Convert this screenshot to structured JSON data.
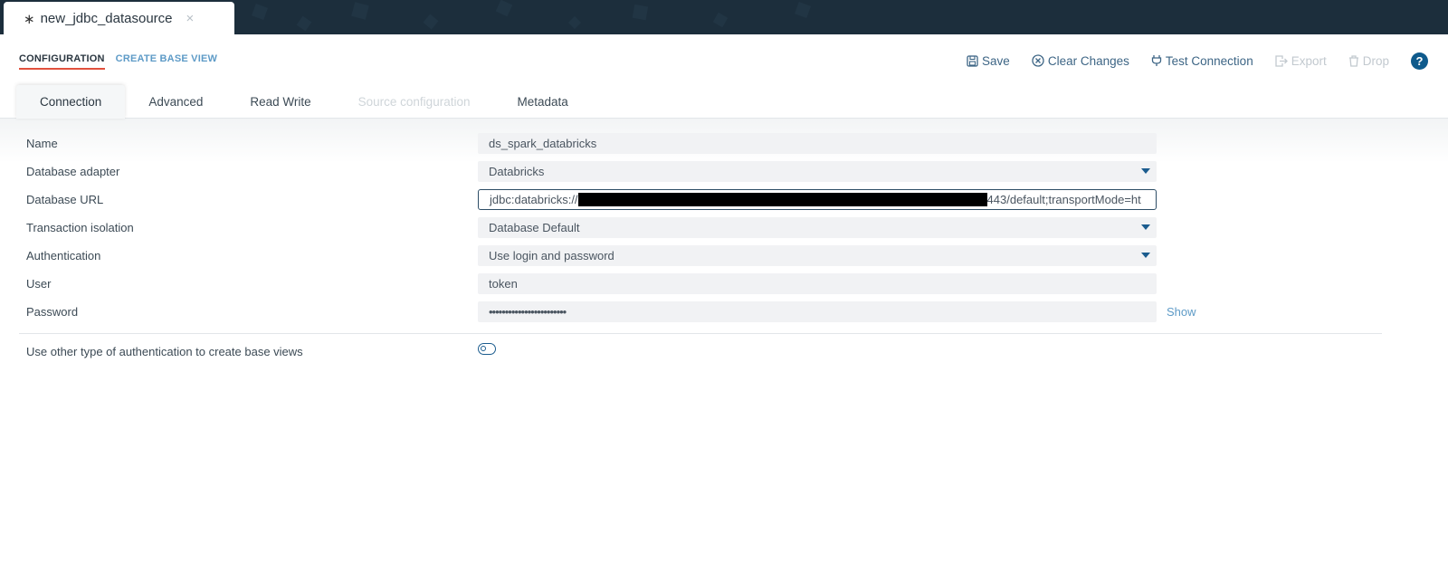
{
  "file_tab": {
    "modified_marker": "∗",
    "title": "new_jdbc_datasource",
    "close": "×"
  },
  "section_nav": {
    "configuration": "CONFIGURATION",
    "create_base_view": "CREATE BASE VIEW"
  },
  "toolbar": {
    "save": "Save",
    "clear_changes": "Clear Changes",
    "test_connection": "Test Connection",
    "export": "Export",
    "drop": "Drop",
    "help": "?"
  },
  "subtabs": {
    "connection": "Connection",
    "advanced": "Advanced",
    "read_write": "Read Write",
    "source_configuration": "Source configuration",
    "metadata": "Metadata"
  },
  "form": {
    "name": {
      "label": "Name",
      "value": "ds_spark_databricks"
    },
    "database_adapter": {
      "label": "Database adapter",
      "value": "Databricks"
    },
    "database_url": {
      "label": "Database URL",
      "prefix": "jdbc:databricks://",
      "suffix": "443/default;transportMode=ht"
    },
    "transaction_isolation": {
      "label": "Transaction isolation",
      "value": "Database Default"
    },
    "authentication": {
      "label": "Authentication",
      "value": "Use login and password"
    },
    "user": {
      "label": "User",
      "value": "token"
    },
    "password": {
      "label": "Password",
      "value": "••••••••••••••••••••••••",
      "show": "Show"
    },
    "other_auth": {
      "label": "Use other type of authentication to create base views",
      "enabled": false
    }
  },
  "colors": {
    "accent": "#e1503c",
    "link": "#5e9bc7",
    "primary": "#1b5c8e",
    "topbar": "#1c2e3c"
  }
}
